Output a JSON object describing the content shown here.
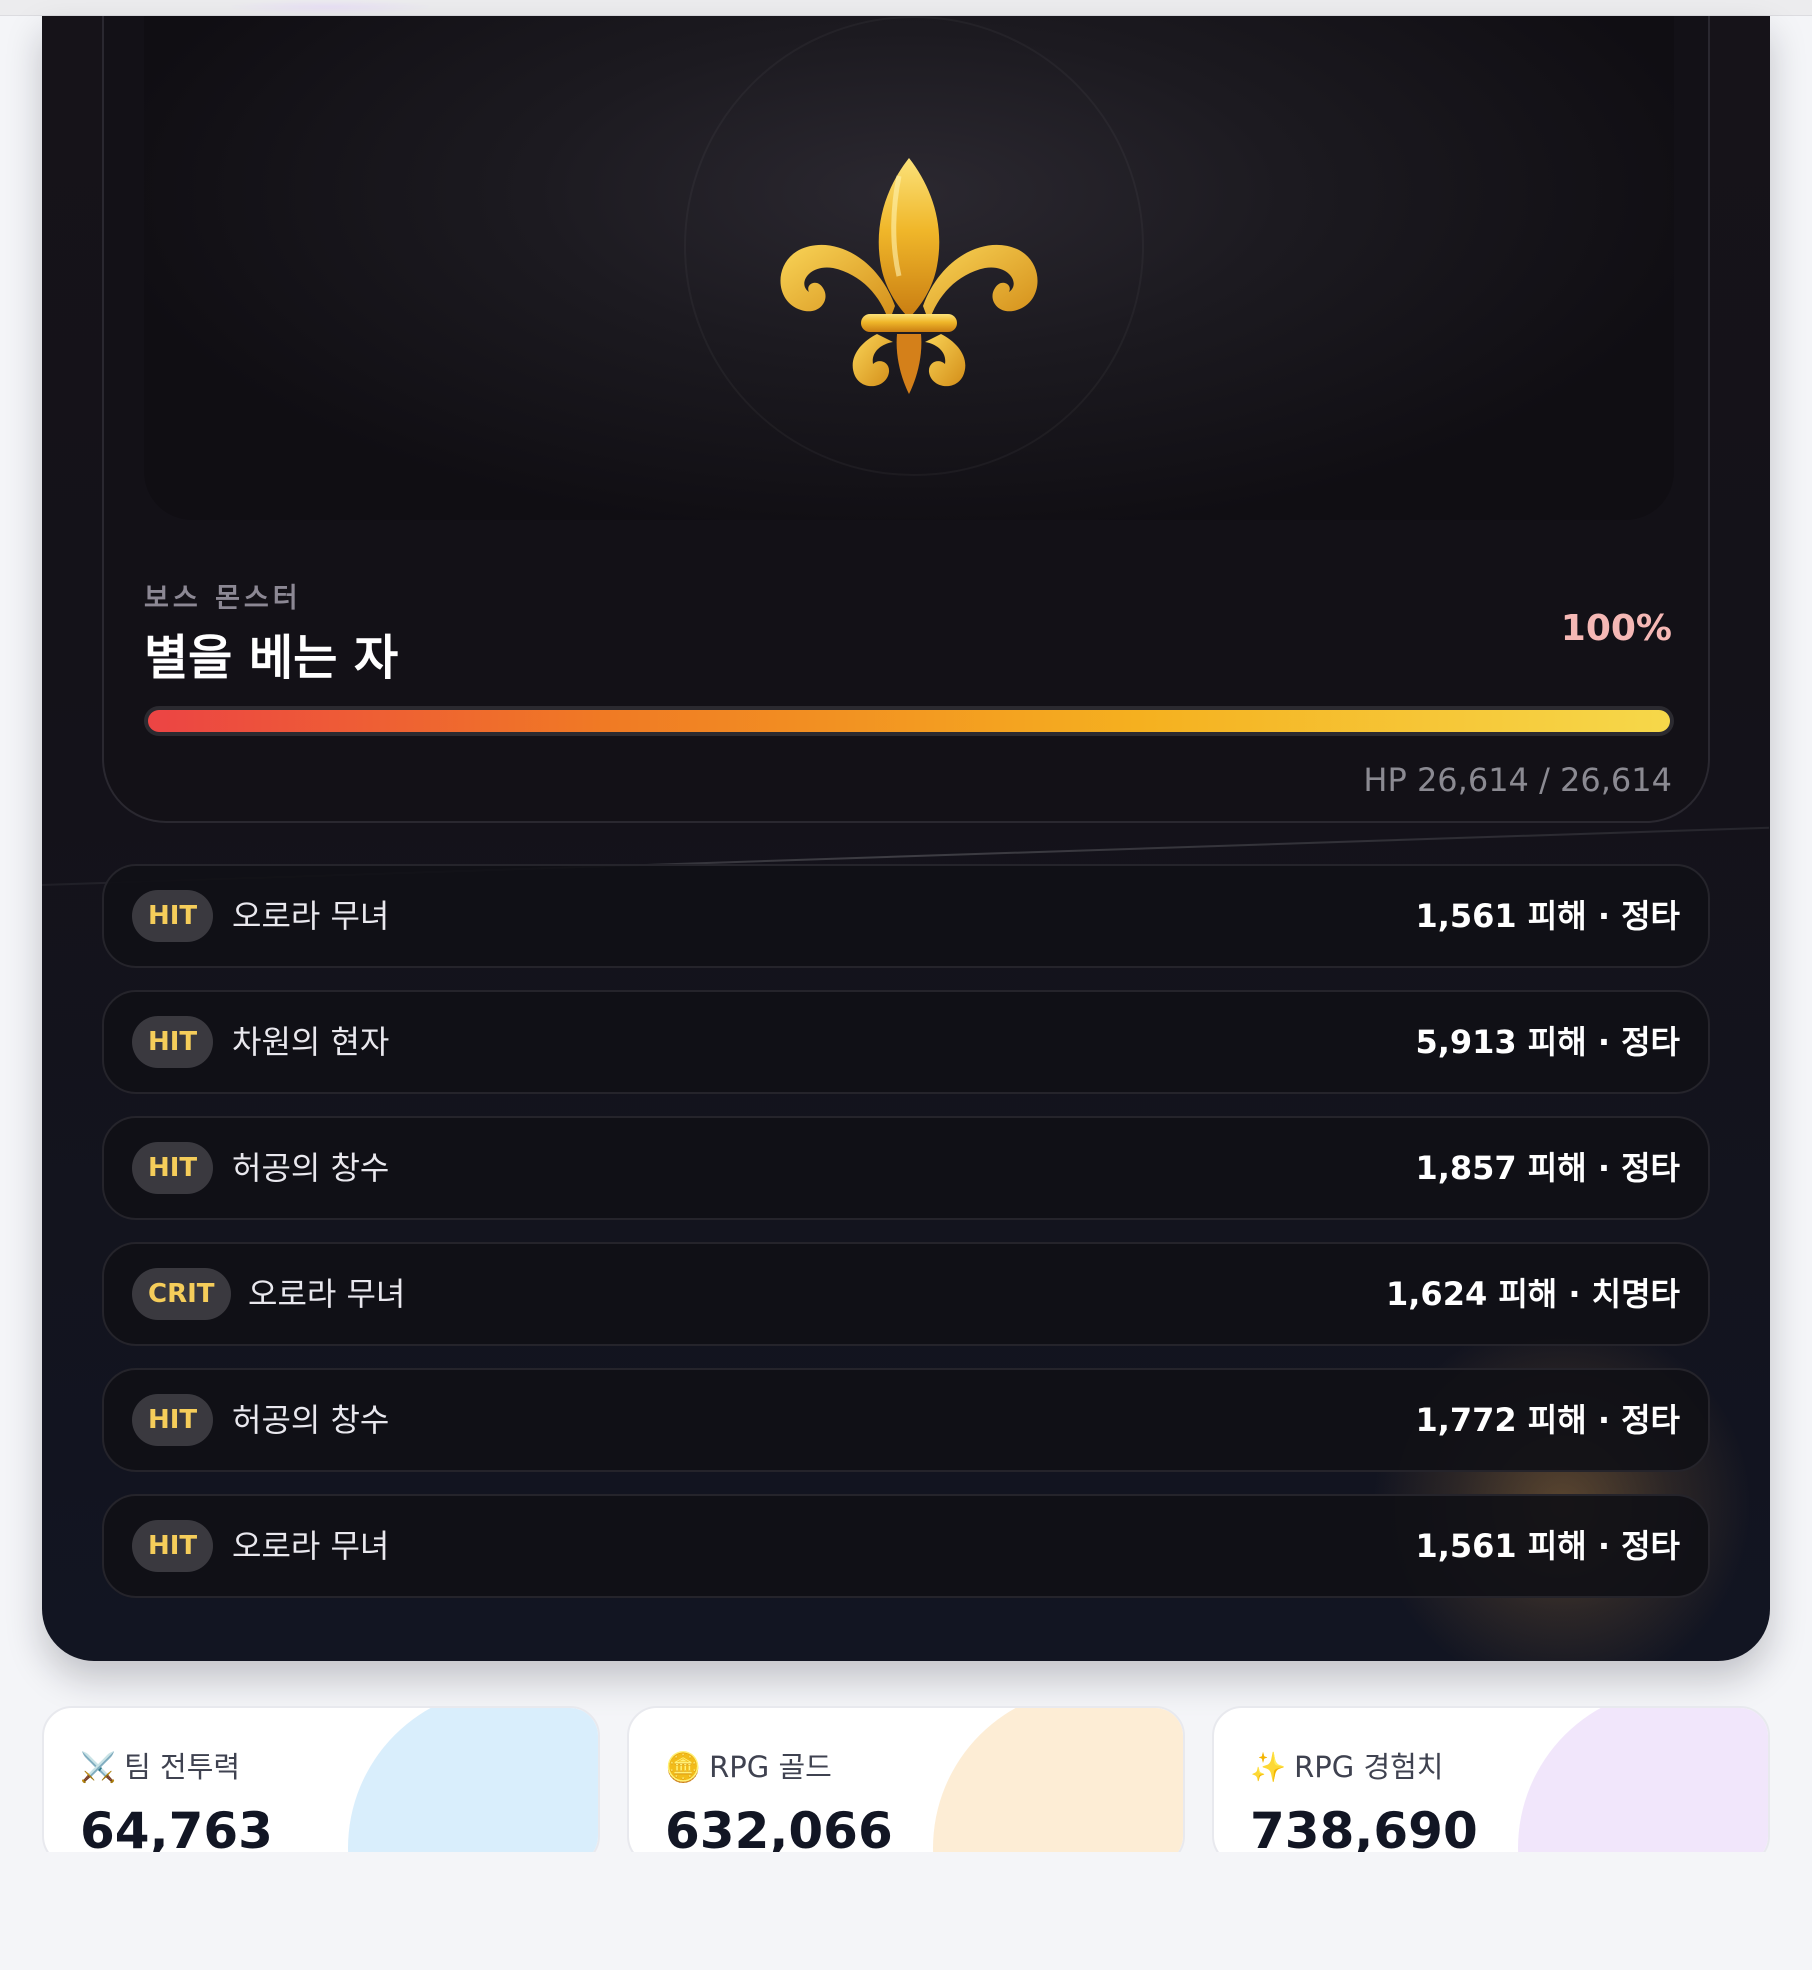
{
  "boss": {
    "subtitle": "보스 몬스터",
    "name": "별을 베는 자",
    "hp_percent_label": "100%",
    "hp_fraction": 1.0,
    "hp_text": "HP 26,614 / 26,614",
    "icon": "fleur-de-lis-icon"
  },
  "battle_log": [
    {
      "badge": "HIT",
      "name": "오로라 무녀",
      "damage": "1,561 피해 · 정타"
    },
    {
      "badge": "HIT",
      "name": "차원의 현자",
      "damage": "5,913 피해 · 정타"
    },
    {
      "badge": "HIT",
      "name": "허공의 창수",
      "damage": "1,857 피해 · 정타"
    },
    {
      "badge": "CRIT",
      "name": "오로라 무녀",
      "damage": "1,624 피해 · 치명타"
    },
    {
      "badge": "HIT",
      "name": "허공의 창수",
      "damage": "1,772 피해 · 정타"
    },
    {
      "badge": "HIT",
      "name": "오로라 무녀",
      "damage": "1,561 피해 · 정타"
    }
  ],
  "stats": [
    {
      "icon": "crossed-swords-icon",
      "glyph": "⚔️",
      "label": "팀 전투력",
      "value": "64,763",
      "accent": "#d9eefc"
    },
    {
      "icon": "coin-icon",
      "glyph": "🪙",
      "label": "RPG 골드",
      "value": "632,066",
      "accent": "#fdedd5"
    },
    {
      "icon": "sparkles-icon",
      "glyph": "✨",
      "label": "RPG 경험치",
      "value": "738,690",
      "accent": "#f1e6fb"
    }
  ],
  "colors": {
    "panel_bg": "#141219",
    "badge_text": "#f5cd5a",
    "hp_percent": "#f5b8b5",
    "hp_start": "#ec4444",
    "hp_end": "#f6d84a"
  }
}
